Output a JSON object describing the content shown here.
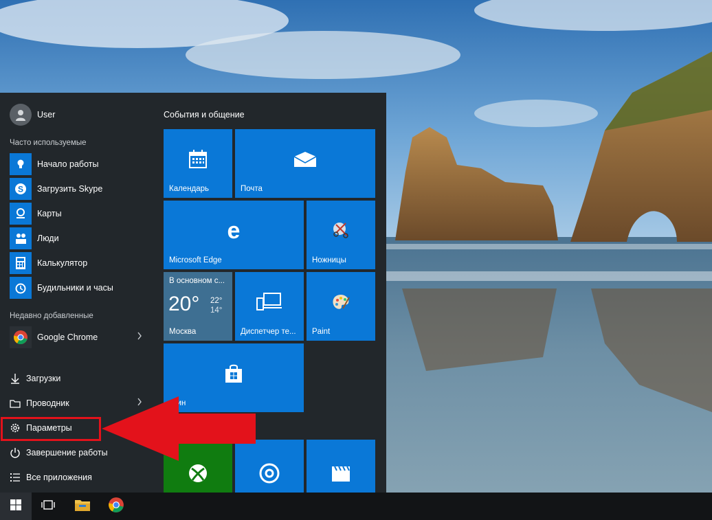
{
  "user": {
    "name": "User"
  },
  "sections": {
    "most_used": "Часто используемые",
    "recently_added": "Недавно добавленные"
  },
  "most_used": [
    {
      "label": "Начало работы",
      "icon": "lightbulb-icon"
    },
    {
      "label": "Загрузить Skype",
      "icon": "skype-icon"
    },
    {
      "label": "Карты",
      "icon": "map-pin-icon"
    },
    {
      "label": "Люди",
      "icon": "people-icon"
    },
    {
      "label": "Калькулятор",
      "icon": "calculator-icon"
    },
    {
      "label": "Будильники и часы",
      "icon": "alarm-clock-icon"
    }
  ],
  "recent": [
    {
      "label": "Google Chrome",
      "icon": "chrome-icon"
    }
  ],
  "system": [
    {
      "label": "Загрузки",
      "icon": "download-icon"
    },
    {
      "label": "Проводник",
      "icon": "folder-icon"
    },
    {
      "label": "Параметры",
      "icon": "gear-icon"
    },
    {
      "label": "Завершение работы",
      "icon": "power-icon"
    },
    {
      "label": "Все приложения",
      "icon": "list-icon"
    }
  ],
  "tiles_group_title": "События и общение",
  "tiles": {
    "calendar": "Календарь",
    "mail": "Почта",
    "edge": "Microsoft Edge",
    "snipping": "Ножницы",
    "device_manager": "Диспетчер те...",
    "paint": "Paint",
    "store": "азин"
  },
  "weather": {
    "condition": "В основном с...",
    "temp": "20°",
    "high": "22°",
    "low": "14°",
    "city": "Москва"
  },
  "colors": {
    "accent": "#0a78d7",
    "menu_bg": "#22272b",
    "xbox": "#107c10",
    "highlight": "#e3121b",
    "taskbar": "#121416"
  }
}
